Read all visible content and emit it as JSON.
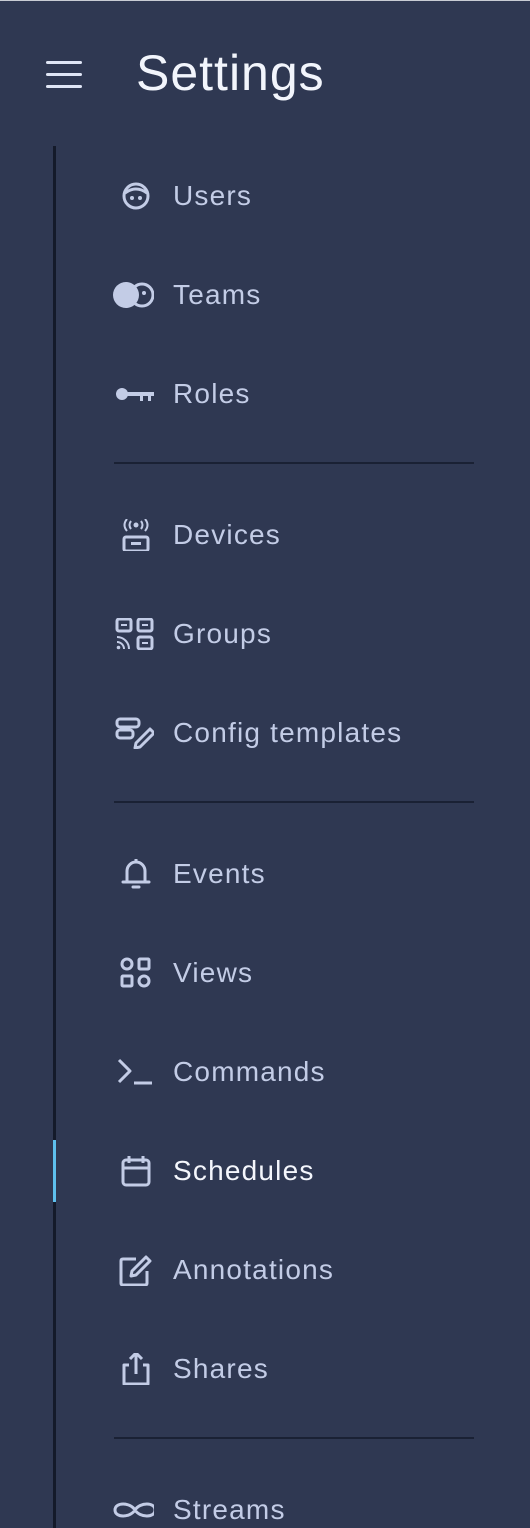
{
  "header": {
    "title": "Settings",
    "menu_icon": "hamburger-menu-icon"
  },
  "nav": {
    "active": "Schedules",
    "groups": [
      {
        "items": [
          {
            "label": "Users",
            "icon": "user-face-icon"
          },
          {
            "label": "Teams",
            "icon": "team-faces-icon"
          },
          {
            "label": "Roles",
            "icon": "key-icon"
          }
        ]
      },
      {
        "items": [
          {
            "label": "Devices",
            "icon": "broadcast-device-icon"
          },
          {
            "label": "Groups",
            "icon": "device-group-icon"
          },
          {
            "label": "Config templates",
            "icon": "config-template-pen-icon"
          }
        ]
      },
      {
        "items": [
          {
            "label": "Events",
            "icon": "bell-icon"
          },
          {
            "label": "Views",
            "icon": "views-shapes-icon"
          },
          {
            "label": "Commands",
            "icon": "terminal-prompt-icon"
          },
          {
            "label": "Schedules",
            "icon": "calendar-icon"
          },
          {
            "label": "Annotations",
            "icon": "edit-note-icon"
          },
          {
            "label": "Shares",
            "icon": "share-upload-icon"
          }
        ]
      },
      {
        "items": [
          {
            "label": "Streams",
            "icon": "infinity-icon"
          }
        ]
      }
    ]
  },
  "colors": {
    "background": "#2f3852",
    "rail": "#141a2a",
    "active_indicator": "#5fc0ee",
    "label": "#c3cce6",
    "active_label": "#f4f6fc"
  }
}
